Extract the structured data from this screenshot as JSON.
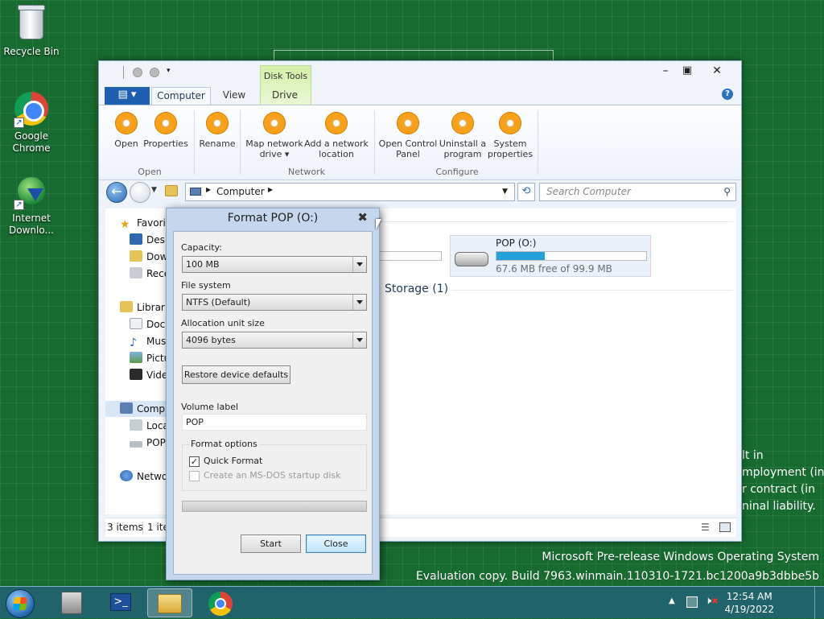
{
  "desktop": {
    "icons": [
      {
        "label": "Recycle Bin"
      },
      {
        "label": "Google Chrome"
      },
      {
        "label": "Internet Downlo..."
      }
    ],
    "behind_text": [
      "lt in",
      "mployment (in",
      "r contract (in",
      "ninal liability."
    ],
    "watermark": {
      "line1": "Microsoft Pre-release Windows Operating System",
      "line2": "Evaluation copy. Build 7963.winmain.110310-1721.bc1200a9b3dbbe5b"
    }
  },
  "explorer": {
    "contextual_tab": "Disk Tools",
    "tabs": [
      "Computer",
      "View",
      "Drive"
    ],
    "ribbon": {
      "buttons": [
        {
          "label": "Open"
        },
        {
          "label": "Properties"
        },
        {
          "label": "Rename"
        },
        {
          "label": "Map network drive ▾"
        },
        {
          "label": "Add a network location"
        },
        {
          "label": "Open Control Panel"
        },
        {
          "label": "Uninstall a program"
        },
        {
          "label": "System properties"
        }
      ],
      "groups": [
        "Open",
        "Network",
        "Configure"
      ]
    },
    "address": {
      "path": "Computer"
    },
    "search": {
      "placeholder": "Search Computer"
    },
    "nav": {
      "favorites": "Favori",
      "favorites_items": [
        "Desk",
        "Dow",
        "Rece"
      ],
      "libraries": "Librari",
      "library_items": [
        "Docu",
        "Musi",
        "Pictu",
        "Vide"
      ],
      "computer": "Comp",
      "computer_items": [
        "Loca",
        "POP"
      ],
      "network": "Netwo"
    },
    "content": {
      "drive": {
        "name": "POP (O:)",
        "free": "67.6 MB free of 99.9 MB",
        "used_fraction": 0.32
      },
      "section": "Storage (1)"
    },
    "status": {
      "items": "3 items",
      "selected": "1 ite"
    }
  },
  "dialog": {
    "title": "Format POP (O:)",
    "capacity_label": "Capacity:",
    "capacity_value": "100 MB",
    "fs_label": "File system",
    "fs_value": "NTFS (Default)",
    "alloc_label": "Allocation unit size",
    "alloc_value": "4096 bytes",
    "restore_label": "Restore device defaults",
    "volume_label": "Volume label",
    "volume_value": "POP",
    "options_label": "Format options",
    "quick_format": "Quick Format",
    "quick_format_checked": true,
    "msdos": "Create an MS-DOS startup disk",
    "progress": 0,
    "start_label": "Start",
    "close_label": "Close"
  },
  "taskbar": {
    "time": "12:54 AM",
    "date": "4/19/2022"
  },
  "colors": {
    "desktop": "#176b30",
    "ribbon_icon": "#f7a11a",
    "file_tab": "#1f5fb0",
    "drive_bar": "#26a0da"
  }
}
